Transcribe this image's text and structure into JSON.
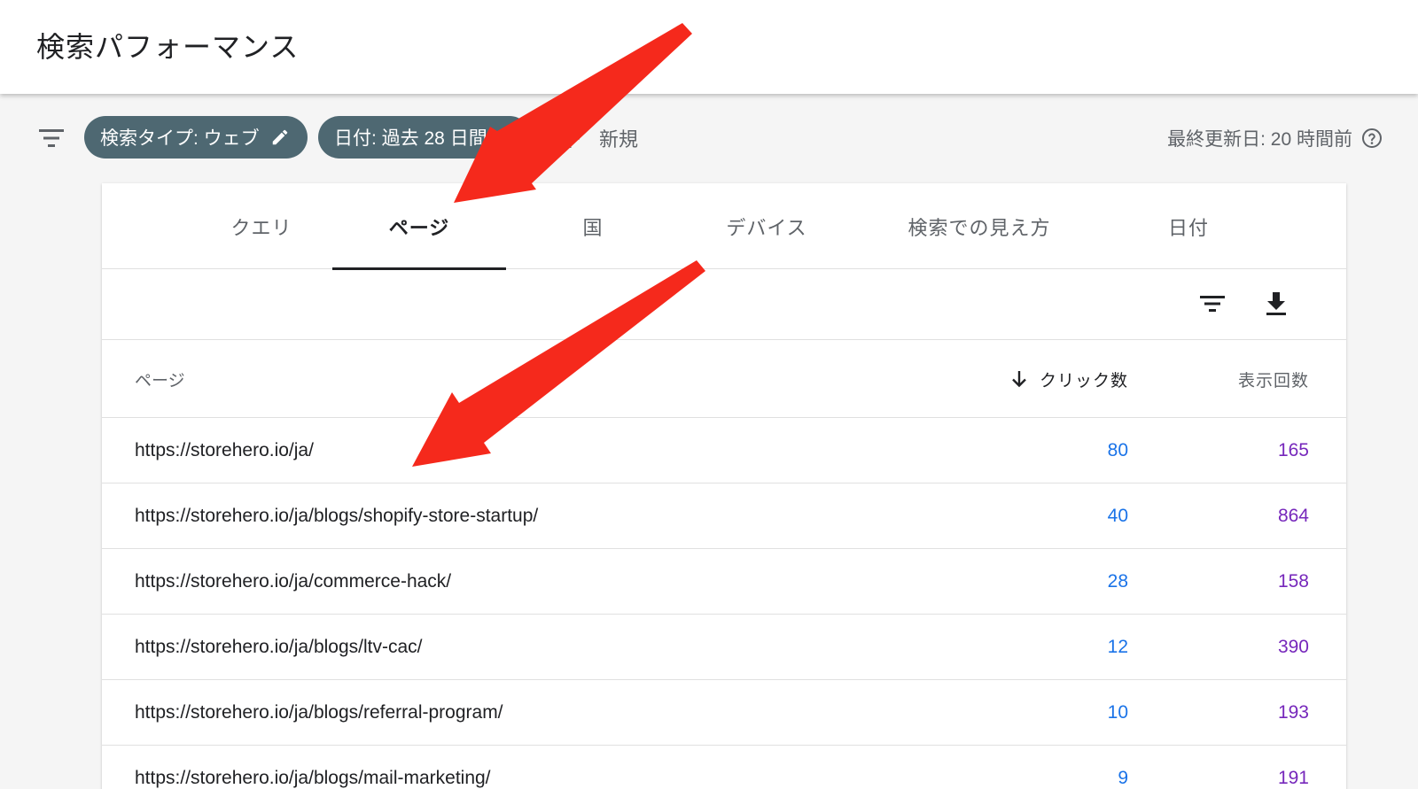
{
  "header": {
    "title": "検索パフォーマンス"
  },
  "filterbar": {
    "chips": [
      {
        "label": "検索タイプ: ウェブ"
      },
      {
        "label": "日付: 過去 28 日間"
      }
    ],
    "new_label": "新規",
    "updated_label": "最終更新日: 20 時間前"
  },
  "tabs": [
    {
      "label": "クエリ",
      "active": false
    },
    {
      "label": "ページ",
      "active": true
    },
    {
      "label": "国",
      "active": false
    },
    {
      "label": "デバイス",
      "active": false
    },
    {
      "label": "検索での見え方",
      "active": false
    },
    {
      "label": "日付",
      "active": false
    }
  ],
  "table": {
    "columns": {
      "page": "ページ",
      "clicks": "クリック数",
      "impressions": "表示回数"
    },
    "rows": [
      {
        "url": "https://storehero.io/ja/",
        "clicks": "80",
        "impressions": "165"
      },
      {
        "url": "https://storehero.io/ja/blogs/shopify-store-startup/",
        "clicks": "40",
        "impressions": "864"
      },
      {
        "url": "https://storehero.io/ja/commerce-hack/",
        "clicks": "28",
        "impressions": "158"
      },
      {
        "url": "https://storehero.io/ja/blogs/ltv-cac/",
        "clicks": "12",
        "impressions": "390"
      },
      {
        "url": "https://storehero.io/ja/blogs/referral-program/",
        "clicks": "10",
        "impressions": "193"
      },
      {
        "url": "https://storehero.io/ja/blogs/mail-marketing/",
        "clicks": "9",
        "impressions": "191"
      }
    ]
  },
  "colors": {
    "chip": "#4e6872",
    "clicks": "#1a73e8",
    "impressions": "#7627bb",
    "annotation_arrow": "#f5291c"
  },
  "icons": [
    "filter-icon",
    "pencil-icon",
    "plus-icon",
    "help-icon",
    "table-filter-icon",
    "download-icon",
    "sort-down-arrow-icon"
  ]
}
